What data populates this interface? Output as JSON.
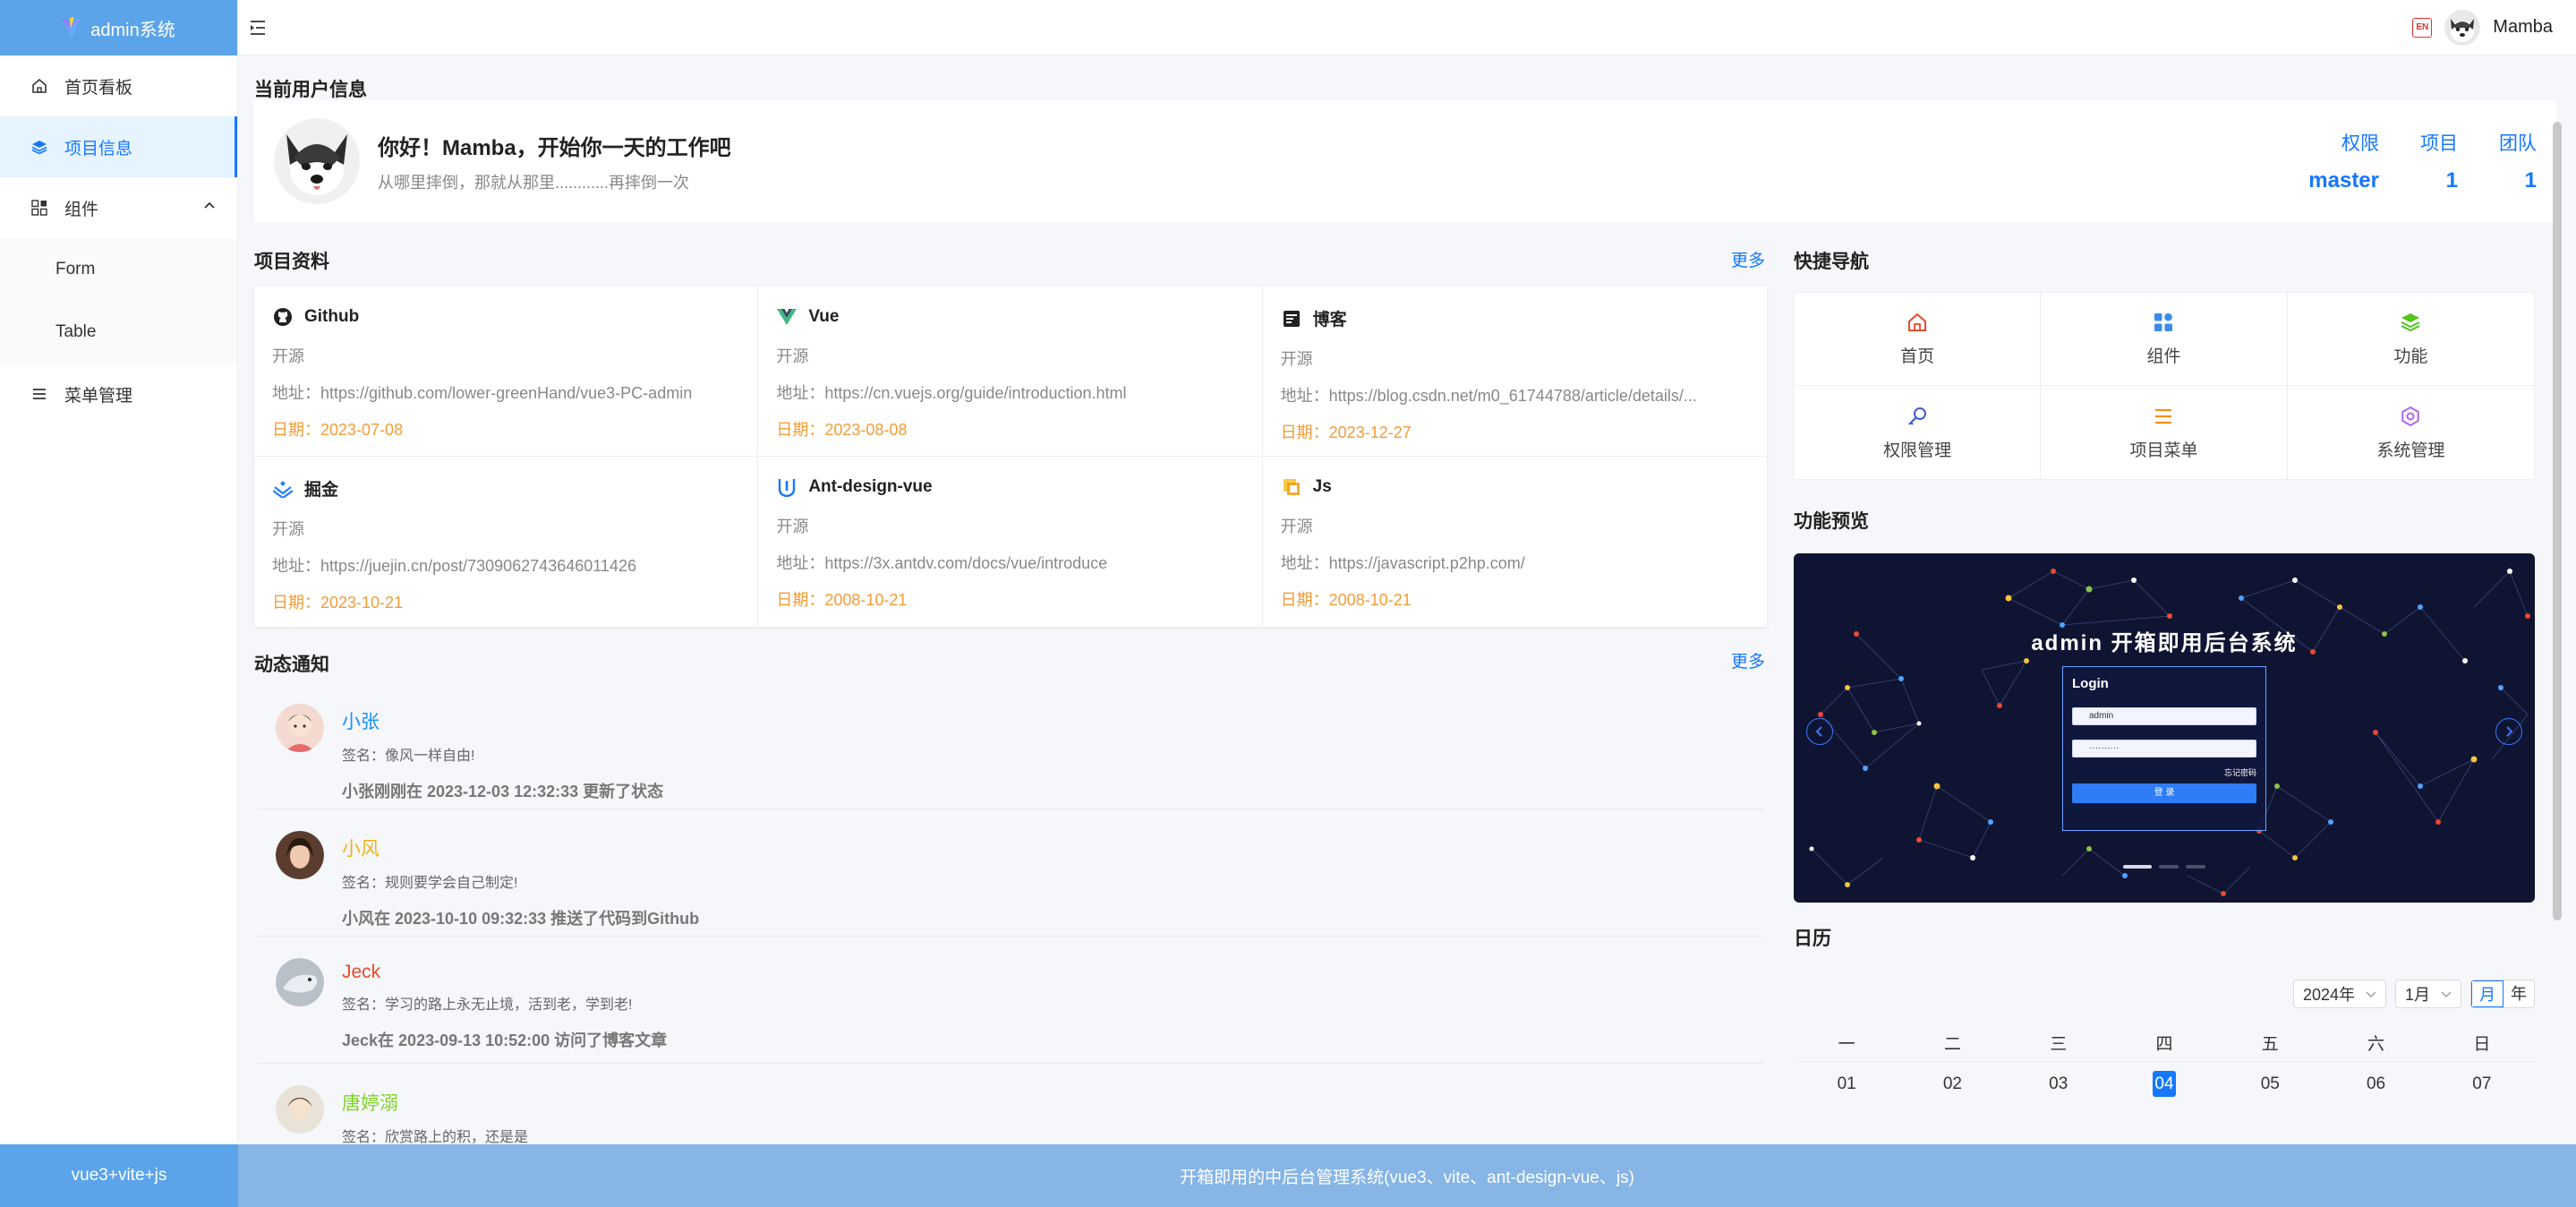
{
  "app": {
    "title": "admin系统"
  },
  "sidebar": {
    "items": [
      {
        "label": "首页看板"
      },
      {
        "label": "项目信息"
      },
      {
        "label": "组件"
      },
      {
        "label": "Form"
      },
      {
        "label": "Table"
      },
      {
        "label": "菜单管理"
      }
    ],
    "footer": "vue3+vite+js"
  },
  "header": {
    "lang": "EN",
    "user": "Mamba"
  },
  "user_info": {
    "title": "当前用户信息",
    "greeting": "你好！Mamba，开始你一天的工作吧",
    "motto": "从哪里摔倒，那就从那里............再摔倒一次",
    "stats": [
      {
        "label": "权限",
        "value": "master"
      },
      {
        "label": "项目",
        "value": "1"
      },
      {
        "label": "团队",
        "value": "1"
      }
    ]
  },
  "projects": {
    "title": "项目资料",
    "more": "更多",
    "items": [
      {
        "name": "Github",
        "type": "开源",
        "url": "地址：https://github.com/lower-greenHand/vue3-PC-admin",
        "date": "日期：2023-07-08",
        "icon": "github-icon"
      },
      {
        "name": "Vue",
        "type": "开源",
        "url": "地址：https://cn.vuejs.org/guide/introduction.html",
        "date": "日期：2023-08-08",
        "icon": "vue-icon"
      },
      {
        "name": "博客",
        "type": "开源",
        "url": "地址：https://blog.csdn.net/m0_61744788/article/details/...",
        "date": "日期：2023-12-27",
        "icon": "blog-icon"
      },
      {
        "name": "掘金",
        "type": "开源",
        "url": "地址：https://juejin.cn/post/7309062743646011426",
        "date": "日期：2023-10-21",
        "icon": "juejin-icon"
      },
      {
        "name": "Ant-design-vue",
        "type": "开源",
        "url": "地址：https://3x.antdv.com/docs/vue/introduce",
        "date": "日期：2008-10-21",
        "icon": "antd-icon"
      },
      {
        "name": "Js",
        "type": "开源",
        "url": "地址：https://javascript.p2hp.com/",
        "date": "日期：2008-10-21",
        "icon": "js-icon"
      }
    ]
  },
  "notifications": {
    "title": "动态通知",
    "more": "更多",
    "items": [
      {
        "name": "小张",
        "sign": "签名：像风一样自由!",
        "action": "小张刚刚在 2023-12-03 12:32:33 更新了状态",
        "color": "#1890ff"
      },
      {
        "name": "小风",
        "sign": "签名：规则要学会自己制定!",
        "action": "小风在 2023-10-10 09:32:33 推送了代码到Github",
        "color": "#f0b21a"
      },
      {
        "name": "Jeck",
        "sign": "签名：学习的路上永无止境，活到老，学到老!",
        "action": "Jeck在 2023-09-13 10:52:00 访问了博客文章",
        "color": "#e84a2f"
      },
      {
        "name": "唐婷溺",
        "sign": "签名：欣赏路上的积，还是是",
        "action": "",
        "color": "#7ed321"
      }
    ]
  },
  "quick_nav": {
    "title": "快捷导航",
    "items": [
      {
        "label": "首页",
        "icon": "home-icon",
        "color": "#e84a2f"
      },
      {
        "label": "组件",
        "icon": "components-icon",
        "color": "#3b8beb"
      },
      {
        "label": "功能",
        "icon": "layers-icon",
        "color": "#52c41a"
      },
      {
        "label": "权限管理",
        "icon": "key-icon",
        "color": "#3b5bdb"
      },
      {
        "label": "项目菜单",
        "icon": "menu-icon",
        "color": "#fa8c16"
      },
      {
        "label": "系统管理",
        "icon": "gear-icon",
        "color": "#b163e8"
      }
    ]
  },
  "preview": {
    "title": "功能预览",
    "banner": "admin 开箱即用后台系统",
    "login_title": "Login",
    "username": "admin",
    "password": "··········",
    "remember": "忘记密码",
    "login_btn": "登 录"
  },
  "calendar": {
    "title": "日历",
    "year": "2024年",
    "month": "1月",
    "mode_month": "月",
    "mode_year": "年",
    "weekdays": [
      "一",
      "二",
      "三",
      "四",
      "五",
      "六",
      "日"
    ],
    "days": [
      "01",
      "02",
      "03",
      "04",
      "05",
      "06",
      "07"
    ],
    "today": "04"
  },
  "footer": {
    "text": "开箱即用的中后台管理系统(vue3、vite、ant-design-vue、js)"
  }
}
